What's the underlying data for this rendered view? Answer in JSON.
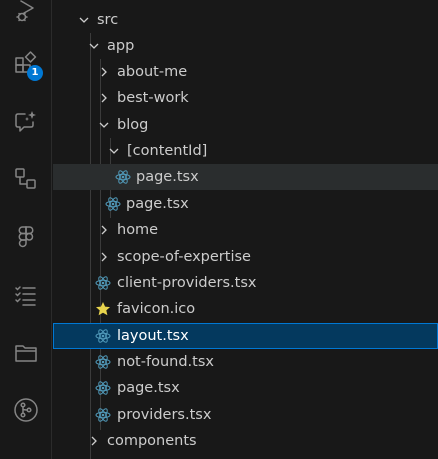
{
  "activity_bar": {
    "extensions_badge": "1",
    "icons": [
      "run-debug-icon",
      "extensions-icon",
      "chat-icon",
      "remote-explorer-icon",
      "figma-icon",
      "tasks-icon",
      "folder-icon",
      "source-control-icon"
    ]
  },
  "explorer": {
    "items": [
      {
        "label": "src",
        "kind": "folder-open"
      },
      {
        "label": "app",
        "kind": "folder-open"
      },
      {
        "label": "about-me",
        "kind": "folder-closed"
      },
      {
        "label": "best-work",
        "kind": "folder-closed"
      },
      {
        "label": "blog",
        "kind": "folder-open"
      },
      {
        "label": "[contentId]",
        "kind": "folder-open"
      },
      {
        "label": "page.tsx",
        "kind": "react-file",
        "state": "hover"
      },
      {
        "label": "page.tsx",
        "kind": "react-file"
      },
      {
        "label": "home",
        "kind": "folder-closed"
      },
      {
        "label": "scope-of-expertise",
        "kind": "folder-closed"
      },
      {
        "label": "client-providers.tsx",
        "kind": "react-file"
      },
      {
        "label": "favicon.ico",
        "kind": "star-file"
      },
      {
        "label": "layout.tsx",
        "kind": "react-file",
        "state": "selected"
      },
      {
        "label": "not-found.tsx",
        "kind": "react-file"
      },
      {
        "label": "page.tsx",
        "kind": "react-file"
      },
      {
        "label": "providers.tsx",
        "kind": "react-file"
      },
      {
        "label": "components",
        "kind": "folder-closed"
      }
    ]
  },
  "colors": {
    "background": "#181818",
    "selection": "#04395e",
    "focus_border": "#0078d4",
    "react_icon": "#519aba",
    "star_icon": "#e8d44d",
    "badge": "#0078d4"
  }
}
